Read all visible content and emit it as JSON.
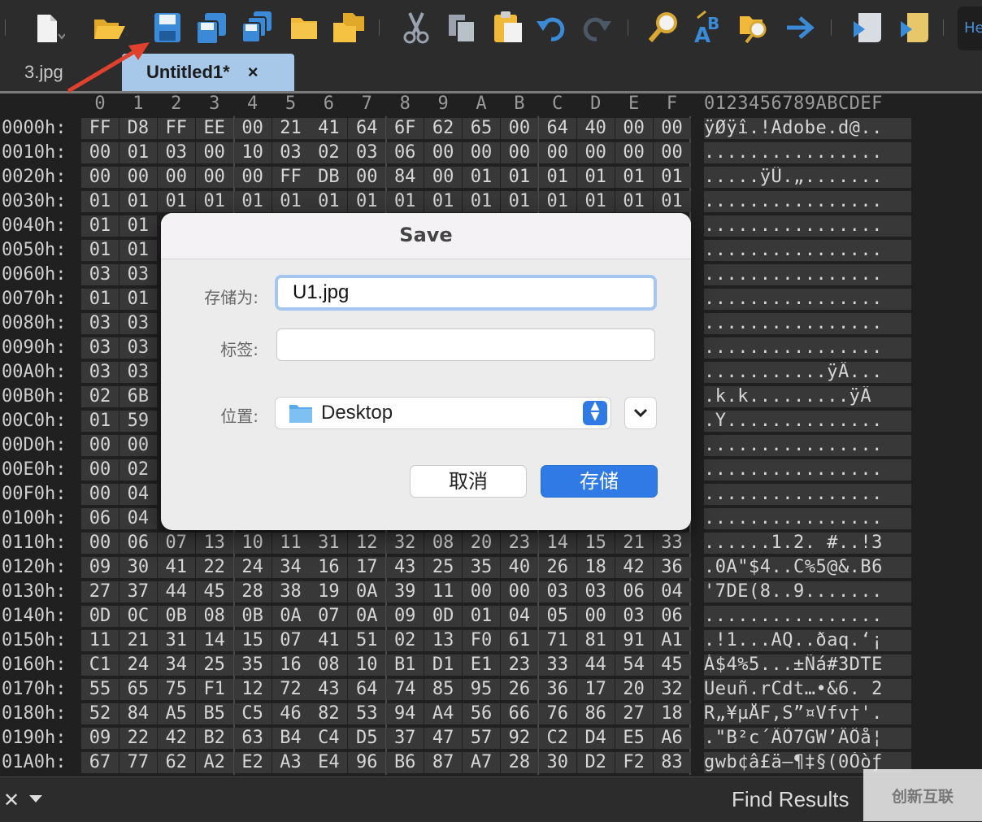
{
  "toolbar": {
    "buttons": [
      "new-file-icon",
      "open-folder-icon",
      "save-icon",
      "save-as-icon",
      "save-all-icon",
      "folder-icon",
      "open-multiple-icon",
      "cut-icon",
      "copy-icon",
      "paste-icon",
      "undo-icon",
      "redo-icon",
      "find-icon",
      "replace-icon",
      "find-in-files-icon",
      "goto-icon",
      "script-icon",
      "template-icon"
    ],
    "help_label": "He"
  },
  "tabs": [
    {
      "label": "3.jpg",
      "active": false
    },
    {
      "label": "Untitled1*",
      "active": true,
      "close": "×"
    }
  ],
  "hex": {
    "columns": [
      "0",
      "1",
      "2",
      "3",
      "4",
      "5",
      "6",
      "7",
      "8",
      "9",
      "A",
      "B",
      "C",
      "D",
      "E",
      "F"
    ],
    "ascii_header": "0123456789ABCDEF",
    "rows": [
      {
        "addr": "0000h:",
        "bytes": [
          "FF",
          "D8",
          "FF",
          "EE",
          "00",
          "21",
          "41",
          "64",
          "6F",
          "62",
          "65",
          "00",
          "64",
          "40",
          "00",
          "00"
        ],
        "ascii": "ÿØÿî.!Adobe.d@.."
      },
      {
        "addr": "0010h:",
        "bytes": [
          "00",
          "01",
          "03",
          "00",
          "10",
          "03",
          "02",
          "03",
          "06",
          "00",
          "00",
          "00",
          "00",
          "00",
          "00",
          "00"
        ],
        "ascii": "................"
      },
      {
        "addr": "0020h:",
        "bytes": [
          "00",
          "00",
          "00",
          "00",
          "00",
          "FF",
          "DB",
          "00",
          "84",
          "00",
          "01",
          "01",
          "01",
          "01",
          "01",
          "01"
        ],
        "ascii": ".....ÿÛ.„......."
      },
      {
        "addr": "0030h:",
        "bytes": [
          "01",
          "01",
          "01",
          "01",
          "01",
          "01",
          "01",
          "01",
          "01",
          "01",
          "01",
          "01",
          "01",
          "01",
          "01",
          "01"
        ],
        "ascii": "................"
      },
      {
        "addr": "0040h:",
        "bytes": [
          "01",
          "01"
        ],
        "ascii": "................"
      },
      {
        "addr": "0050h:",
        "bytes": [
          "01",
          "01"
        ],
        "ascii": "................"
      },
      {
        "addr": "0060h:",
        "bytes": [
          "03",
          "03"
        ],
        "ascii": "................"
      },
      {
        "addr": "0070h:",
        "bytes": [
          "01",
          "01"
        ],
        "ascii": "................"
      },
      {
        "addr": "0080h:",
        "bytes": [
          "03",
          "03"
        ],
        "ascii": "................"
      },
      {
        "addr": "0090h:",
        "bytes": [
          "03",
          "03"
        ],
        "ascii": "................"
      },
      {
        "addr": "00A0h:",
        "bytes": [
          "03",
          "03"
        ],
        "ascii": "...........ÿÂ..."
      },
      {
        "addr": "00B0h:",
        "bytes": [
          "02",
          "6B"
        ],
        "ascii": ".k.k.........ÿÄ"
      },
      {
        "addr": "00C0h:",
        "bytes": [
          "01",
          "59"
        ],
        "ascii": ".Y.............."
      },
      {
        "addr": "00D0h:",
        "bytes": [
          "00",
          "00"
        ],
        "ascii": "................"
      },
      {
        "addr": "00E0h:",
        "bytes": [
          "00",
          "02"
        ],
        "ascii": "................"
      },
      {
        "addr": "00F0h:",
        "bytes": [
          "00",
          "04"
        ],
        "ascii": "................"
      },
      {
        "addr": "0100h:",
        "bytes": [
          "06",
          "04"
        ],
        "ascii": "................"
      },
      {
        "addr": "0110h:",
        "bytes": [
          "00",
          "06",
          "07",
          "13",
          "10",
          "11",
          "31",
          "12",
          "32",
          "08",
          "20",
          "23",
          "14",
          "15",
          "21",
          "33"
        ],
        "ascii": "......1.2. #..!3"
      },
      {
        "addr": "0120h:",
        "bytes": [
          "09",
          "30",
          "41",
          "22",
          "24",
          "34",
          "16",
          "17",
          "43",
          "25",
          "35",
          "40",
          "26",
          "18",
          "42",
          "36"
        ],
        "ascii": ".0A\"$4..C%5@&.B6"
      },
      {
        "addr": "0130h:",
        "bytes": [
          "27",
          "37",
          "44",
          "45",
          "28",
          "38",
          "19",
          "0A",
          "39",
          "11",
          "00",
          "00",
          "03",
          "03",
          "06",
          "04"
        ],
        "ascii": "'7DE(8..9......."
      },
      {
        "addr": "0140h:",
        "bytes": [
          "0D",
          "0C",
          "0B",
          "08",
          "0B",
          "0A",
          "07",
          "0A",
          "09",
          "0D",
          "01",
          "04",
          "05",
          "00",
          "03",
          "06"
        ],
        "ascii": "................"
      },
      {
        "addr": "0150h:",
        "bytes": [
          "11",
          "21",
          "31",
          "14",
          "15",
          "07",
          "41",
          "51",
          "02",
          "13",
          "F0",
          "61",
          "71",
          "81",
          "91",
          "A1"
        ],
        "ascii": ".!1...AQ..ðaq.‘¡"
      },
      {
        "addr": "0160h:",
        "bytes": [
          "C1",
          "24",
          "34",
          "25",
          "35",
          "16",
          "08",
          "10",
          "B1",
          "D1",
          "E1",
          "23",
          "33",
          "44",
          "54",
          "45"
        ],
        "ascii": "Á$4%5...±Ñá#3DTE"
      },
      {
        "addr": "0170h:",
        "bytes": [
          "55",
          "65",
          "75",
          "F1",
          "12",
          "72",
          "43",
          "64",
          "74",
          "85",
          "95",
          "26",
          "36",
          "17",
          "20",
          "32"
        ],
        "ascii": "Ueuñ.rCdt…•&6. 2"
      },
      {
        "addr": "0180h:",
        "bytes": [
          "52",
          "84",
          "A5",
          "B5",
          "C5",
          "46",
          "82",
          "53",
          "94",
          "A4",
          "56",
          "66",
          "76",
          "86",
          "27",
          "18"
        ],
        "ascii": "R„¥µÅF‚S”¤Vfv†'."
      },
      {
        "addr": "0190h:",
        "bytes": [
          "09",
          "22",
          "42",
          "B2",
          "63",
          "B4",
          "C4",
          "D5",
          "37",
          "47",
          "57",
          "92",
          "C2",
          "D4",
          "E5",
          "A6"
        ],
        "ascii": ".\"B²c´ÄÕ7GW’ÂÔå¦"
      },
      {
        "addr": "01A0h:",
        "bytes": [
          "67",
          "77",
          "62",
          "A2",
          "E2",
          "A3",
          "E4",
          "96",
          "B6",
          "87",
          "A7",
          "28",
          "30",
          "D2",
          "F2",
          "83"
        ],
        "ascii": "gwb¢â£ä–¶‡§(0Òòƒ"
      }
    ]
  },
  "dialog": {
    "title": "Save",
    "save_as_label": "存储为:",
    "save_as_value": "U1.jpg",
    "tags_label": "标签:",
    "tags_value": "",
    "location_label": "位置:",
    "location_value": "Desktop",
    "cancel_label": "取消",
    "save_label": "存储"
  },
  "status": {
    "close": "✕",
    "find_results": "Find Results"
  },
  "watermark": "创新互联",
  "colors": {
    "accent": "#2f7ae5",
    "tab_active": "#a7c8e8",
    "arrow": "#e0412c"
  }
}
